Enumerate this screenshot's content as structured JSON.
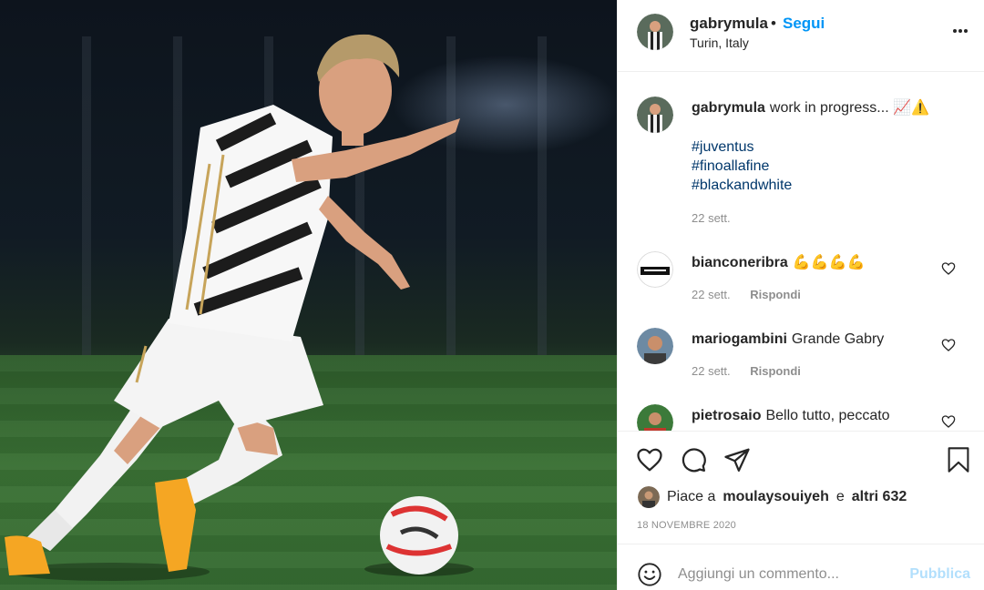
{
  "post": {
    "image_alt": "Juventus player dribbling a football on the pitch",
    "author": {
      "username": "gabrymula",
      "follow_label": "Segui",
      "separator": "•",
      "location": "Turin, Italy"
    },
    "more_icon": "ellipsis-icon",
    "caption": {
      "username": "gabrymula",
      "text": "work in progress... 📈⚠️",
      "hashtags": [
        "#juventus",
        "#finoallafine",
        "#blackandwhite"
      ],
      "time": "22 sett."
    },
    "comments": [
      {
        "username": "bianconeribra",
        "text": "💪💪💪💪",
        "time": "22 sett.",
        "reply_label": "Rispondi"
      },
      {
        "username": "mariogambini",
        "text": "Grande Gabry",
        "time": "22 sett.",
        "reply_label": "Rispondi"
      },
      {
        "username": "pietrosaio",
        "text": "Bello tutto, peccato",
        "time": "",
        "reply_label": ""
      }
    ],
    "likes": {
      "prefix": "Piace a",
      "user": "moulaysouiyeh",
      "connector": "e",
      "others": "altri 632"
    },
    "date": "18 NOVEMBRE 2020",
    "add_comment": {
      "placeholder": "Aggiungi un commento...",
      "post_label": "Pubblica"
    },
    "colors": {
      "link_blue": "#0095f6",
      "hashtag_blue": "#00376b",
      "muted": "#8e8e8e",
      "post_disabled": "#b2dffc",
      "text": "#262626"
    }
  }
}
